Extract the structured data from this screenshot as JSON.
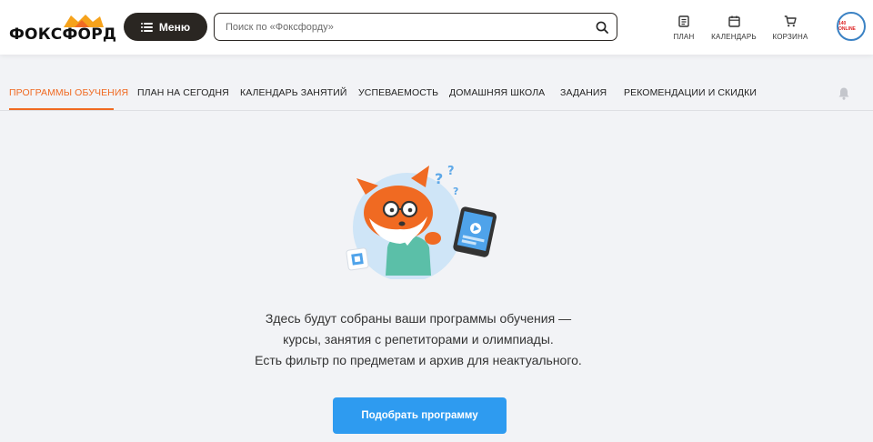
{
  "header": {
    "logo_text": "ФОКСФОРД",
    "menu_label": "Меню",
    "search_placeholder": "Поиск по «Фоксфорду»",
    "actions": [
      {
        "label": "ПЛАН",
        "icon": "document-icon"
      },
      {
        "label": "КАЛЕНДАРЬ",
        "icon": "calendar-icon"
      },
      {
        "label": "КОРЗИНА",
        "icon": "cart-icon"
      }
    ],
    "avatar_text": "140 ONLINE"
  },
  "tabs": [
    {
      "label": "ПРОГРАММЫ ОБУЧЕНИЯ",
      "active": true
    },
    {
      "label": "ПЛАН НА СЕГОДНЯ",
      "active": false
    },
    {
      "label": "КАЛЕНДАРЬ ЗАНЯТИЙ",
      "active": false
    },
    {
      "label": "УСПЕВАЕМОСТЬ",
      "active": false
    },
    {
      "label": "ДОМАШНЯЯ ШКОЛА",
      "active": false
    },
    {
      "label": "ЗАДАНИЯ",
      "active": false
    },
    {
      "label": "РЕКОМЕНДАЦИИ И СКИДКИ",
      "active": false
    }
  ],
  "empty_state": {
    "lines": [
      "Здесь будут собраны ваши программы обучения —",
      "курсы, занятия с репетиторами и олимпиады.",
      "Есть фильтр по предметам и архив для неактуального."
    ],
    "button_label": "Подобрать программу"
  },
  "colors": {
    "accent": "#f06a22",
    "primary_button": "#2e9bf0",
    "menu_button": "#2a2622",
    "background": "#f2f3f6"
  }
}
